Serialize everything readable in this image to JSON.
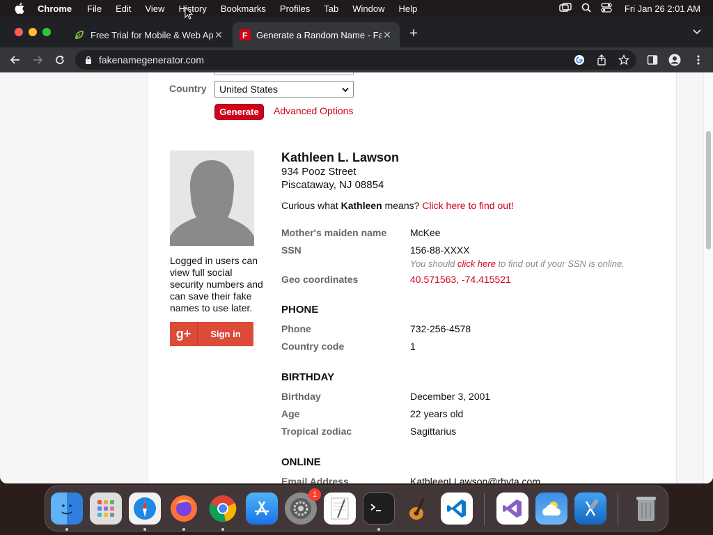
{
  "menubar": {
    "app_name": "Chrome",
    "items": [
      "File",
      "Edit",
      "View",
      "History",
      "Bookmarks",
      "Profiles",
      "Tab",
      "Window",
      "Help"
    ],
    "clock": "Fri Jan 26  2:01 AM"
  },
  "tabs": [
    {
      "title": "Free Trial for Mobile & Web App",
      "active": false
    },
    {
      "title": "Generate a Random Name - Fa",
      "active": true
    }
  ],
  "address_bar": {
    "url": "fakenamegenerator.com"
  },
  "form": {
    "country_label": "Country",
    "country_value": "United States",
    "generate_label": "Generate",
    "advanced_label": "Advanced Options"
  },
  "sidebar": {
    "note": "Logged in users can view full social security numbers and can save their fake names to use later.",
    "signin_icon": "g+",
    "signin_label": "Sign in"
  },
  "identity": {
    "name": "Kathleen L. Lawson",
    "street": "934 Pooz Street",
    "city": "Piscataway, NJ 08854",
    "curious_prefix": "Curious what ",
    "first_name": "Kathleen",
    "curious_suffix": " means? ",
    "curious_link": "Click here to find out!",
    "fields": {
      "maiden_label": "Mother's maiden name",
      "maiden_value": "McKee",
      "ssn_label": "SSN",
      "ssn_value": "156-88-XXXX",
      "ssn_note_prefix": "You should ",
      "ssn_note_link": "click here",
      "ssn_note_suffix": " to find out if your SSN is online.",
      "geo_label": "Geo coordinates",
      "geo_value": "40.571563, -74.415521"
    }
  },
  "phone_section": {
    "heading": "PHONE",
    "phone_label": "Phone",
    "phone_value": "732-256-4578",
    "cc_label": "Country code",
    "cc_value": "1"
  },
  "birthday_section": {
    "heading": "BIRTHDAY",
    "birthday_label": "Birthday",
    "birthday_value": "December 3, 2001",
    "age_label": "Age",
    "age_value": "22 years old",
    "zodiac_label": "Tropical zodiac",
    "zodiac_value": "Sagittarius"
  },
  "online_section": {
    "heading": "ONLINE",
    "email_label": "Email Address",
    "email_value": "KathleenLLawson@rhyta.com"
  },
  "dock": {
    "apps": [
      "Finder",
      "Launchpad",
      "Safari",
      "Firefox",
      "Chrome",
      "App Store",
      "System Settings",
      "TextEdit",
      "Terminal",
      "GarageBand",
      "VS Code",
      "Visual Studio",
      "Weather",
      "Xcode",
      "Trash"
    ],
    "settings_badge": "1"
  },
  "colors": {
    "accent": "#d0021b",
    "google_red": "#dc4a38"
  }
}
